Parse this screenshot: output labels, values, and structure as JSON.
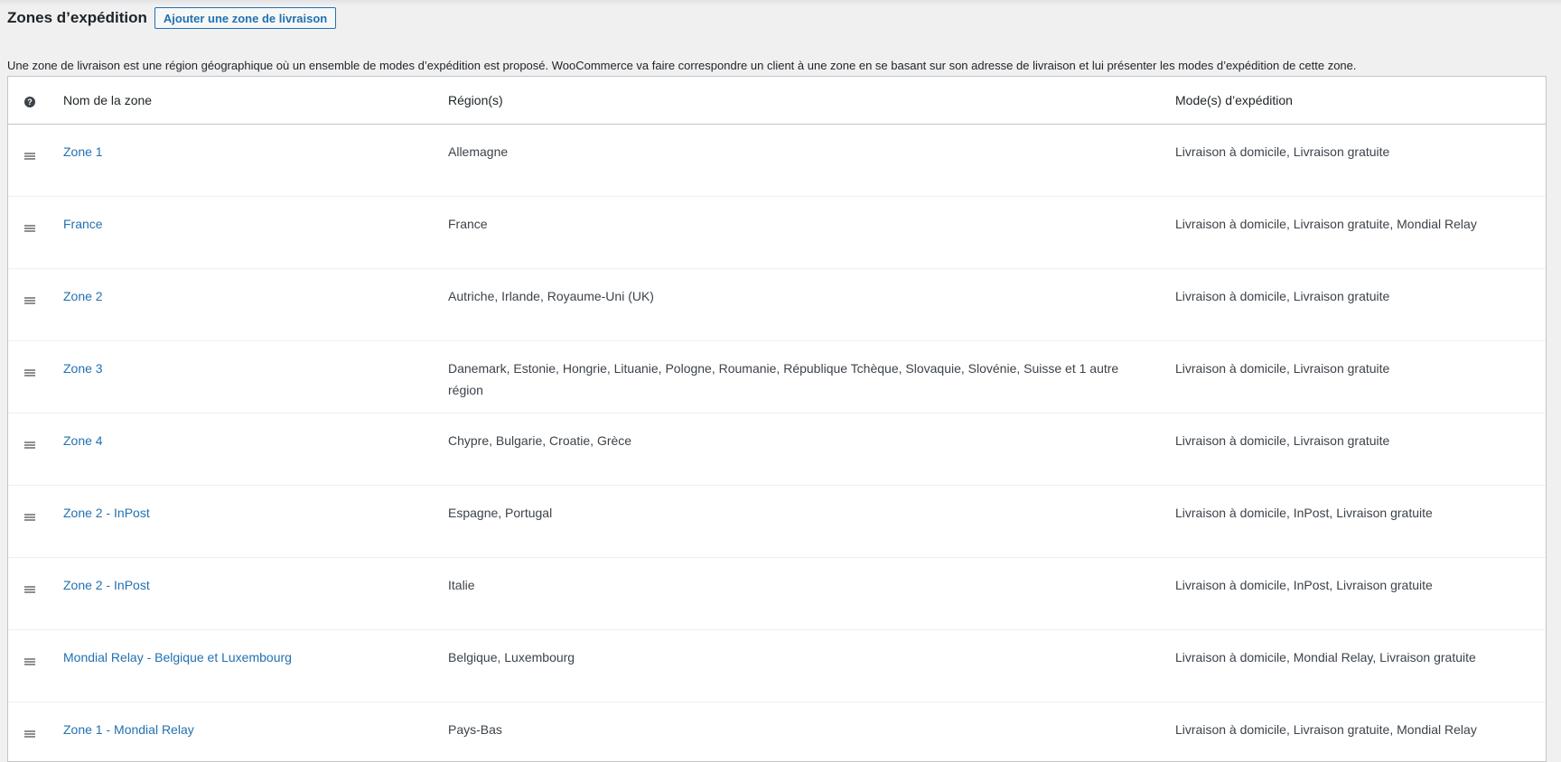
{
  "header": {
    "title": "Zones d’expédition",
    "add_button": "Ajouter une zone de livraison"
  },
  "description": "Une zone de livraison est une région géographique où un ensemble de modes d’expédition est proposé. WooCommerce va faire correspondre un client à une zone en se basant sur son adresse de livraison et lui présenter les modes d’expédition de cette zone.",
  "table": {
    "help_icon": "question-circle-icon",
    "columns": {
      "name": "Nom de la zone",
      "regions": "Région(s)",
      "methods": "Mode(s) d’expédition"
    },
    "rows": [
      {
        "name": "Zone 1",
        "regions": "Allemagne",
        "methods": "Livraison à domicile, Livraison gratuite"
      },
      {
        "name": "France",
        "regions": "France",
        "methods": "Livraison à domicile, Livraison gratuite, Mondial Relay"
      },
      {
        "name": "Zone 2",
        "regions": "Autriche, Irlande, Royaume-Uni (UK)",
        "methods": "Livraison à domicile, Livraison gratuite"
      },
      {
        "name": "Zone 3",
        "regions": "Danemark, Estonie, Hongrie, Lituanie, Pologne, Roumanie, République Tchèque, Slovaquie, Slovénie, Suisse et 1 autre région",
        "methods": "Livraison à domicile, Livraison gratuite"
      },
      {
        "name": "Zone 4",
        "regions": "Chypre, Bulgarie, Croatie, Grèce",
        "methods": "Livraison à domicile, Livraison gratuite"
      },
      {
        "name": "Zone 2 - InPost",
        "regions": "Espagne, Portugal",
        "methods": "Livraison à domicile, InPost, Livraison gratuite"
      },
      {
        "name": "Zone 2 - InPost",
        "regions": "Italie",
        "methods": "Livraison à domicile, InPost, Livraison gratuite"
      },
      {
        "name": "Mondial Relay - Belgique et Luxembourg",
        "regions": "Belgique, Luxembourg",
        "methods": "Livraison à domicile, Mondial Relay, Livraison gratuite"
      },
      {
        "name": "Zone 1 - Mondial Relay",
        "regions": "Pays-Bas",
        "methods": "Livraison à domicile, Livraison gratuite, Mondial Relay"
      }
    ]
  },
  "colors": {
    "link": "#2271b1",
    "text": "#1d2327",
    "background": "#f0f0f1"
  }
}
